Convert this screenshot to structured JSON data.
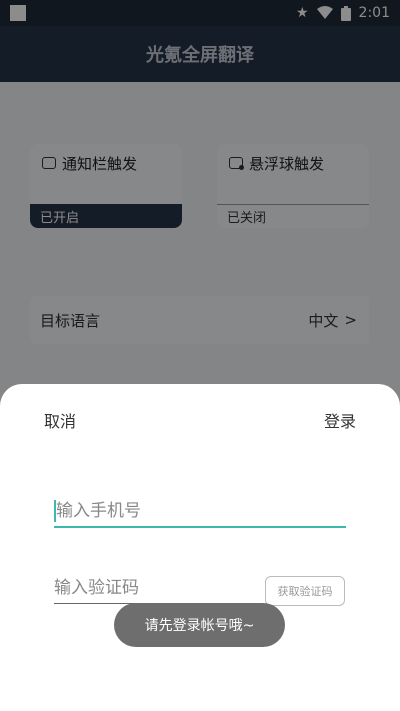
{
  "status_bar": {
    "time": "2:01",
    "icons": [
      "notification-square-icon",
      "star-icon",
      "wifi-icon",
      "battery-icon"
    ]
  },
  "app": {
    "title": "光氪全屏翻译"
  },
  "triggers": [
    {
      "label": "通知栏触发",
      "status": "已开启",
      "icon": "notification-bar-icon"
    },
    {
      "label": "悬浮球触发",
      "status": "已关闭",
      "icon": "floating-ball-icon"
    }
  ],
  "target_language": {
    "label": "目标语言",
    "value": "中文",
    "chevron": ">"
  },
  "login_sheet": {
    "cancel_label": "取消",
    "login_label": "登录",
    "phone_placeholder": "输入手机号",
    "code_placeholder": "输入验证码",
    "get_code_label": "获取验证码"
  },
  "toast": {
    "message": "请先登录帐号哦~"
  },
  "colors": {
    "header_bg": "#263348",
    "accent": "#3db8b0",
    "toast_bg": "#6e6e6e"
  }
}
